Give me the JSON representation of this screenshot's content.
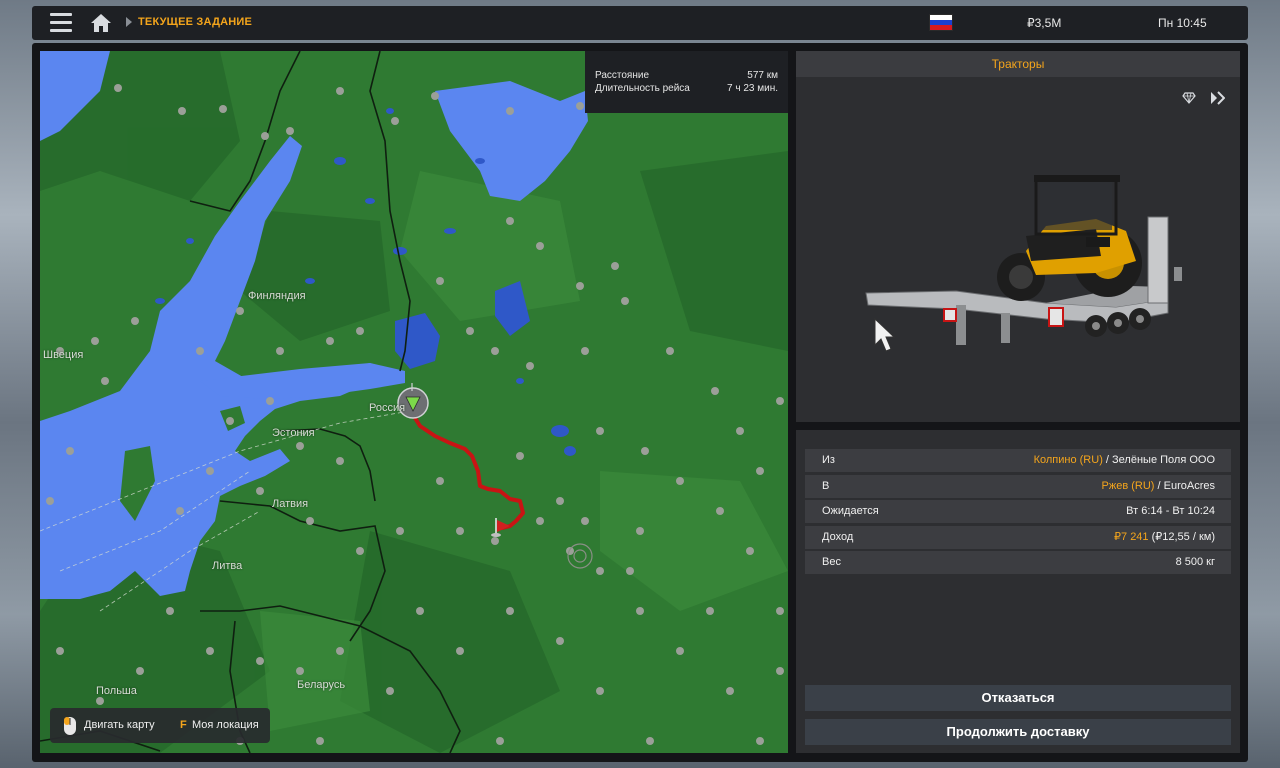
{
  "topbar": {
    "menu_icon": "hamburger-menu-icon",
    "home_icon": "home-icon",
    "breadcrumb": "ТЕКУЩЕЕ ЗАДАНИЕ",
    "money": "₽3,5M",
    "clock": "Пн 10:45",
    "flag": "russia-flag-icon"
  },
  "map": {
    "trip": {
      "distance_label": "Расстояние",
      "distance_value": "577 км",
      "duration_label": "Длительность рейса",
      "duration_value": "7 ч 23 мин."
    },
    "labels": {
      "sweden": "Швеция",
      "finland": "Финляндия",
      "estonia": "Эстония",
      "russia": "Россия",
      "latvia": "Латвия",
      "lithuania": "Литва",
      "poland": "Польша",
      "belarus": "Беларусь"
    },
    "hint": {
      "move_map": "Двигать карту",
      "key": "F",
      "my_location": "Моя локация"
    }
  },
  "cargo": {
    "title": "Тракторы"
  },
  "details": {
    "from_label": "Из",
    "from_city": "Колпино (RU)",
    "from_company": " / Зелёные Поля ООО",
    "to_label": "В",
    "to_city": "Ржев (RU)",
    "to_company": " / EuroAcres",
    "expected_label": "Ожидается",
    "expected_value": "Вт 6:14 - Вт 10:24",
    "income_label": "Доход",
    "income_value": "₽7 241",
    "income_rate": " (₽12,55 / км)",
    "weight_label": "Вес",
    "weight_value": "8 500 кг"
  },
  "actions": {
    "cancel": "Отказаться",
    "continue": "Продолжить доставку"
  },
  "colors": {
    "accent": "#f4a51c",
    "route": "#c81414",
    "land": "#2f7a32",
    "water": "#5b86f0"
  }
}
